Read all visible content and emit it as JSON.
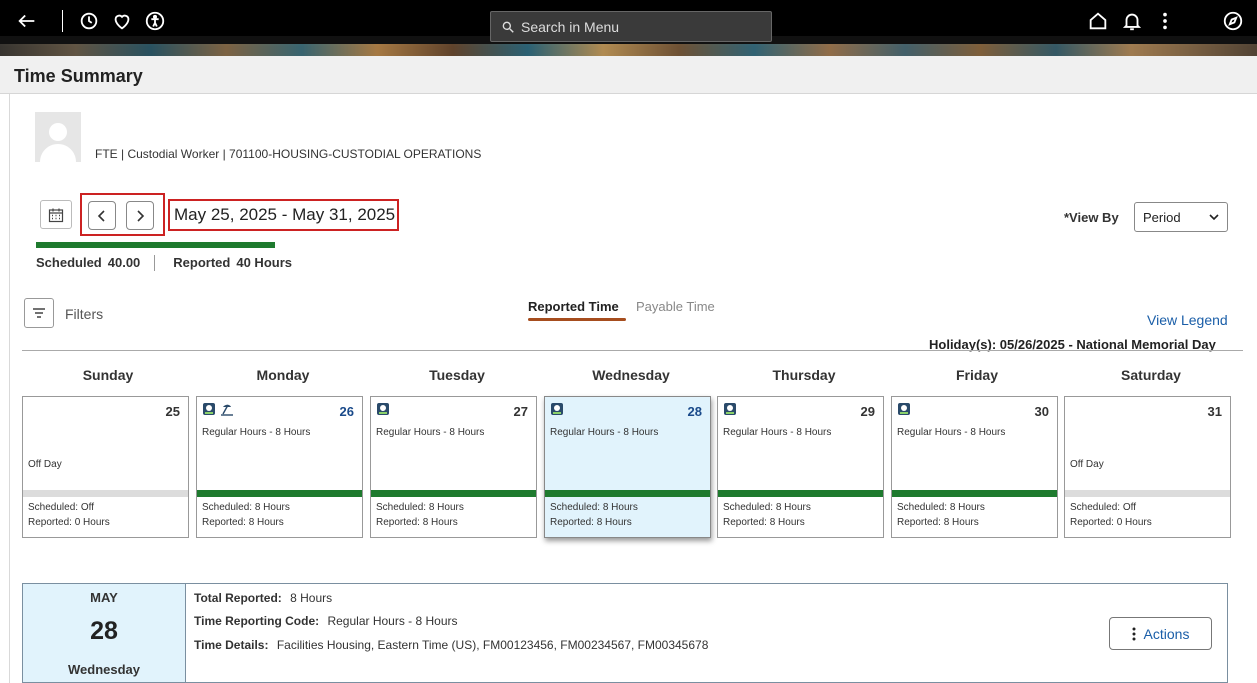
{
  "header": {
    "search_placeholder": "Search in Menu"
  },
  "page": {
    "title": "Time Summary"
  },
  "employee": {
    "info": "FTE | Custodial Worker | 701100-HOUSING-CUSTODIAL OPERATIONS"
  },
  "period": {
    "range": "May 25, 2025 - May 31, 2025",
    "scheduled_label": "Scheduled",
    "scheduled_value": "40.00",
    "reported_label": "Reported",
    "reported_value": "40 Hours",
    "reported_fraction": 1.0
  },
  "view_by": {
    "label": "*View By",
    "selected": "Period"
  },
  "filters": {
    "label": "Filters"
  },
  "tabs": [
    {
      "label": "Reported Time",
      "active": true
    },
    {
      "label": "Payable Time",
      "active": false
    }
  ],
  "legend_link": "View Legend",
  "holiday_note": "Holiday(s): 05/26/2025 - National Memorial Day",
  "days": [
    {
      "weekday": "Sunday",
      "date": "25",
      "trc": "",
      "off": "Off Day",
      "scheduled": "Scheduled: Off",
      "reported": "Reported: 0 Hours",
      "worked": false,
      "holiday": false,
      "selected": false
    },
    {
      "weekday": "Monday",
      "date": "26",
      "trc": "Regular Hours - 8 Hours",
      "off": "",
      "scheduled": "Scheduled: 8 Hours",
      "reported": "Reported: 8 Hours",
      "worked": true,
      "holiday": true,
      "selected": false
    },
    {
      "weekday": "Tuesday",
      "date": "27",
      "trc": "Regular Hours - 8 Hours",
      "off": "",
      "scheduled": "Scheduled: 8 Hours",
      "reported": "Reported: 8 Hours",
      "worked": true,
      "holiday": false,
      "selected": false
    },
    {
      "weekday": "Wednesday",
      "date": "28",
      "trc": "Regular Hours - 8 Hours",
      "off": "",
      "scheduled": "Scheduled: 8 Hours",
      "reported": "Reported: 8 Hours",
      "worked": true,
      "holiday": false,
      "selected": true
    },
    {
      "weekday": "Thursday",
      "date": "29",
      "trc": "Regular Hours - 8 Hours",
      "off": "",
      "scheduled": "Scheduled: 8 Hours",
      "reported": "Reported: 8 Hours",
      "worked": true,
      "holiday": false,
      "selected": false
    },
    {
      "weekday": "Friday",
      "date": "30",
      "trc": "Regular Hours - 8 Hours",
      "off": "",
      "scheduled": "Scheduled: 8 Hours",
      "reported": "Reported: 8 Hours",
      "worked": true,
      "holiday": false,
      "selected": false
    },
    {
      "weekday": "Saturday",
      "date": "31",
      "trc": "",
      "off": "Off Day",
      "scheduled": "Scheduled: Off",
      "reported": "Reported: 0 Hours",
      "worked": false,
      "holiday": false,
      "selected": false
    }
  ],
  "detail": {
    "month": "MAY",
    "day": "28",
    "weekday": "Wednesday",
    "total_label": "Total Reported:",
    "total_value": "8 Hours",
    "trc_label": "Time Reporting Code:",
    "trc_value": "Regular Hours - 8 Hours",
    "details_label": "Time Details:",
    "details_value": "Facilities Housing, Eastern Time (US), FM00123456, FM00234567, FM00345678",
    "actions_label": "Actions"
  },
  "colors": {
    "accent_green": "#1e7a2e",
    "link_blue": "#1a5ea8",
    "selected_bg": "#e1f3fc",
    "highlight_red": "#cc2222"
  }
}
